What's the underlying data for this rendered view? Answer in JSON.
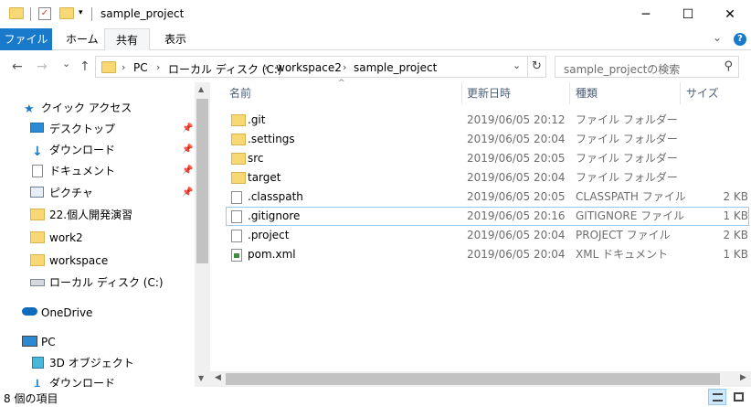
{
  "window": {
    "title": "sample_project",
    "minimize_glyph": "─",
    "maximize_glyph": "☐",
    "close_glyph": "✕"
  },
  "ribbon": {
    "tabs": [
      {
        "label": "ファイル"
      },
      {
        "label": "ホーム"
      },
      {
        "label": "共有"
      },
      {
        "label": "表示"
      }
    ],
    "expand_glyph": "⌄",
    "help_glyph": "?"
  },
  "address": {
    "back_glyph": "←",
    "forward_glyph": "→",
    "recent_glyph": "⌄",
    "up_glyph": "↑",
    "crumbs": [
      "PC",
      "ローカル ディスク (C:)",
      "workspace2",
      "sample_project"
    ],
    "crumb_sep": "›",
    "dropdown_glyph": "⌄",
    "refresh_glyph": "↻"
  },
  "search": {
    "placeholder": "sample_projectの検索",
    "icon_glyph": "⚲"
  },
  "nav": {
    "quick_access": "クイック アクセス",
    "items": [
      {
        "label": "デスクトップ",
        "icon": "desktop-icon",
        "pinned": true
      },
      {
        "label": "ダウンロード",
        "icon": "download-icon",
        "pinned": true
      },
      {
        "label": "ドキュメント",
        "icon": "document-icon",
        "pinned": true
      },
      {
        "label": "ピクチャ",
        "icon": "pictures-icon",
        "pinned": true
      },
      {
        "label": "22.個人開発演習",
        "icon": "folder-icon",
        "pinned": false
      },
      {
        "label": "work2",
        "icon": "folder-icon",
        "pinned": false
      },
      {
        "label": "workspace",
        "icon": "folder-icon",
        "pinned": false
      },
      {
        "label": "ローカル ディスク (C:)",
        "icon": "drive-icon",
        "pinned": false
      }
    ],
    "onedrive": "OneDrive",
    "pc": "PC",
    "pc_items": [
      {
        "label": "3D オブジェクト",
        "icon": "3d-objects-icon"
      },
      {
        "label": "ダウンロード",
        "icon": "download-icon"
      }
    ],
    "pin_glyph": "📌"
  },
  "columns": {
    "name": "名前",
    "date": "更新日時",
    "type": "種類",
    "size": "サイズ",
    "sort_glyph": "^"
  },
  "files": [
    {
      "name": ".git",
      "date": "2019/06/05 20:12",
      "type": "ファイル フォルダー",
      "size": "",
      "icon": "folder-icon"
    },
    {
      "name": ".settings",
      "date": "2019/06/05 20:04",
      "type": "ファイル フォルダー",
      "size": "",
      "icon": "folder-icon"
    },
    {
      "name": "src",
      "date": "2019/06/05 20:05",
      "type": "ファイル フォルダー",
      "size": "",
      "icon": "folder-icon"
    },
    {
      "name": "target",
      "date": "2019/06/05 20:04",
      "type": "ファイル フォルダー",
      "size": "",
      "icon": "folder-icon"
    },
    {
      "name": ".classpath",
      "date": "2019/06/05 20:05",
      "type": "CLASSPATH ファイル",
      "size": "2 KB",
      "icon": "file-icon"
    },
    {
      "name": ".gitignore",
      "date": "2019/06/05 20:16",
      "type": "GITIGNORE ファイル",
      "size": "1 KB",
      "icon": "file-icon"
    },
    {
      "name": ".project",
      "date": "2019/06/05 20:04",
      "type": "PROJECT ファイル",
      "size": "2 KB",
      "icon": "file-icon"
    },
    {
      "name": "pom.xml",
      "date": "2019/06/05 20:04",
      "type": "XML ドキュメント",
      "size": "1 KB",
      "icon": "xml-file-icon"
    }
  ],
  "status": {
    "item_count": "8 個の項目"
  }
}
